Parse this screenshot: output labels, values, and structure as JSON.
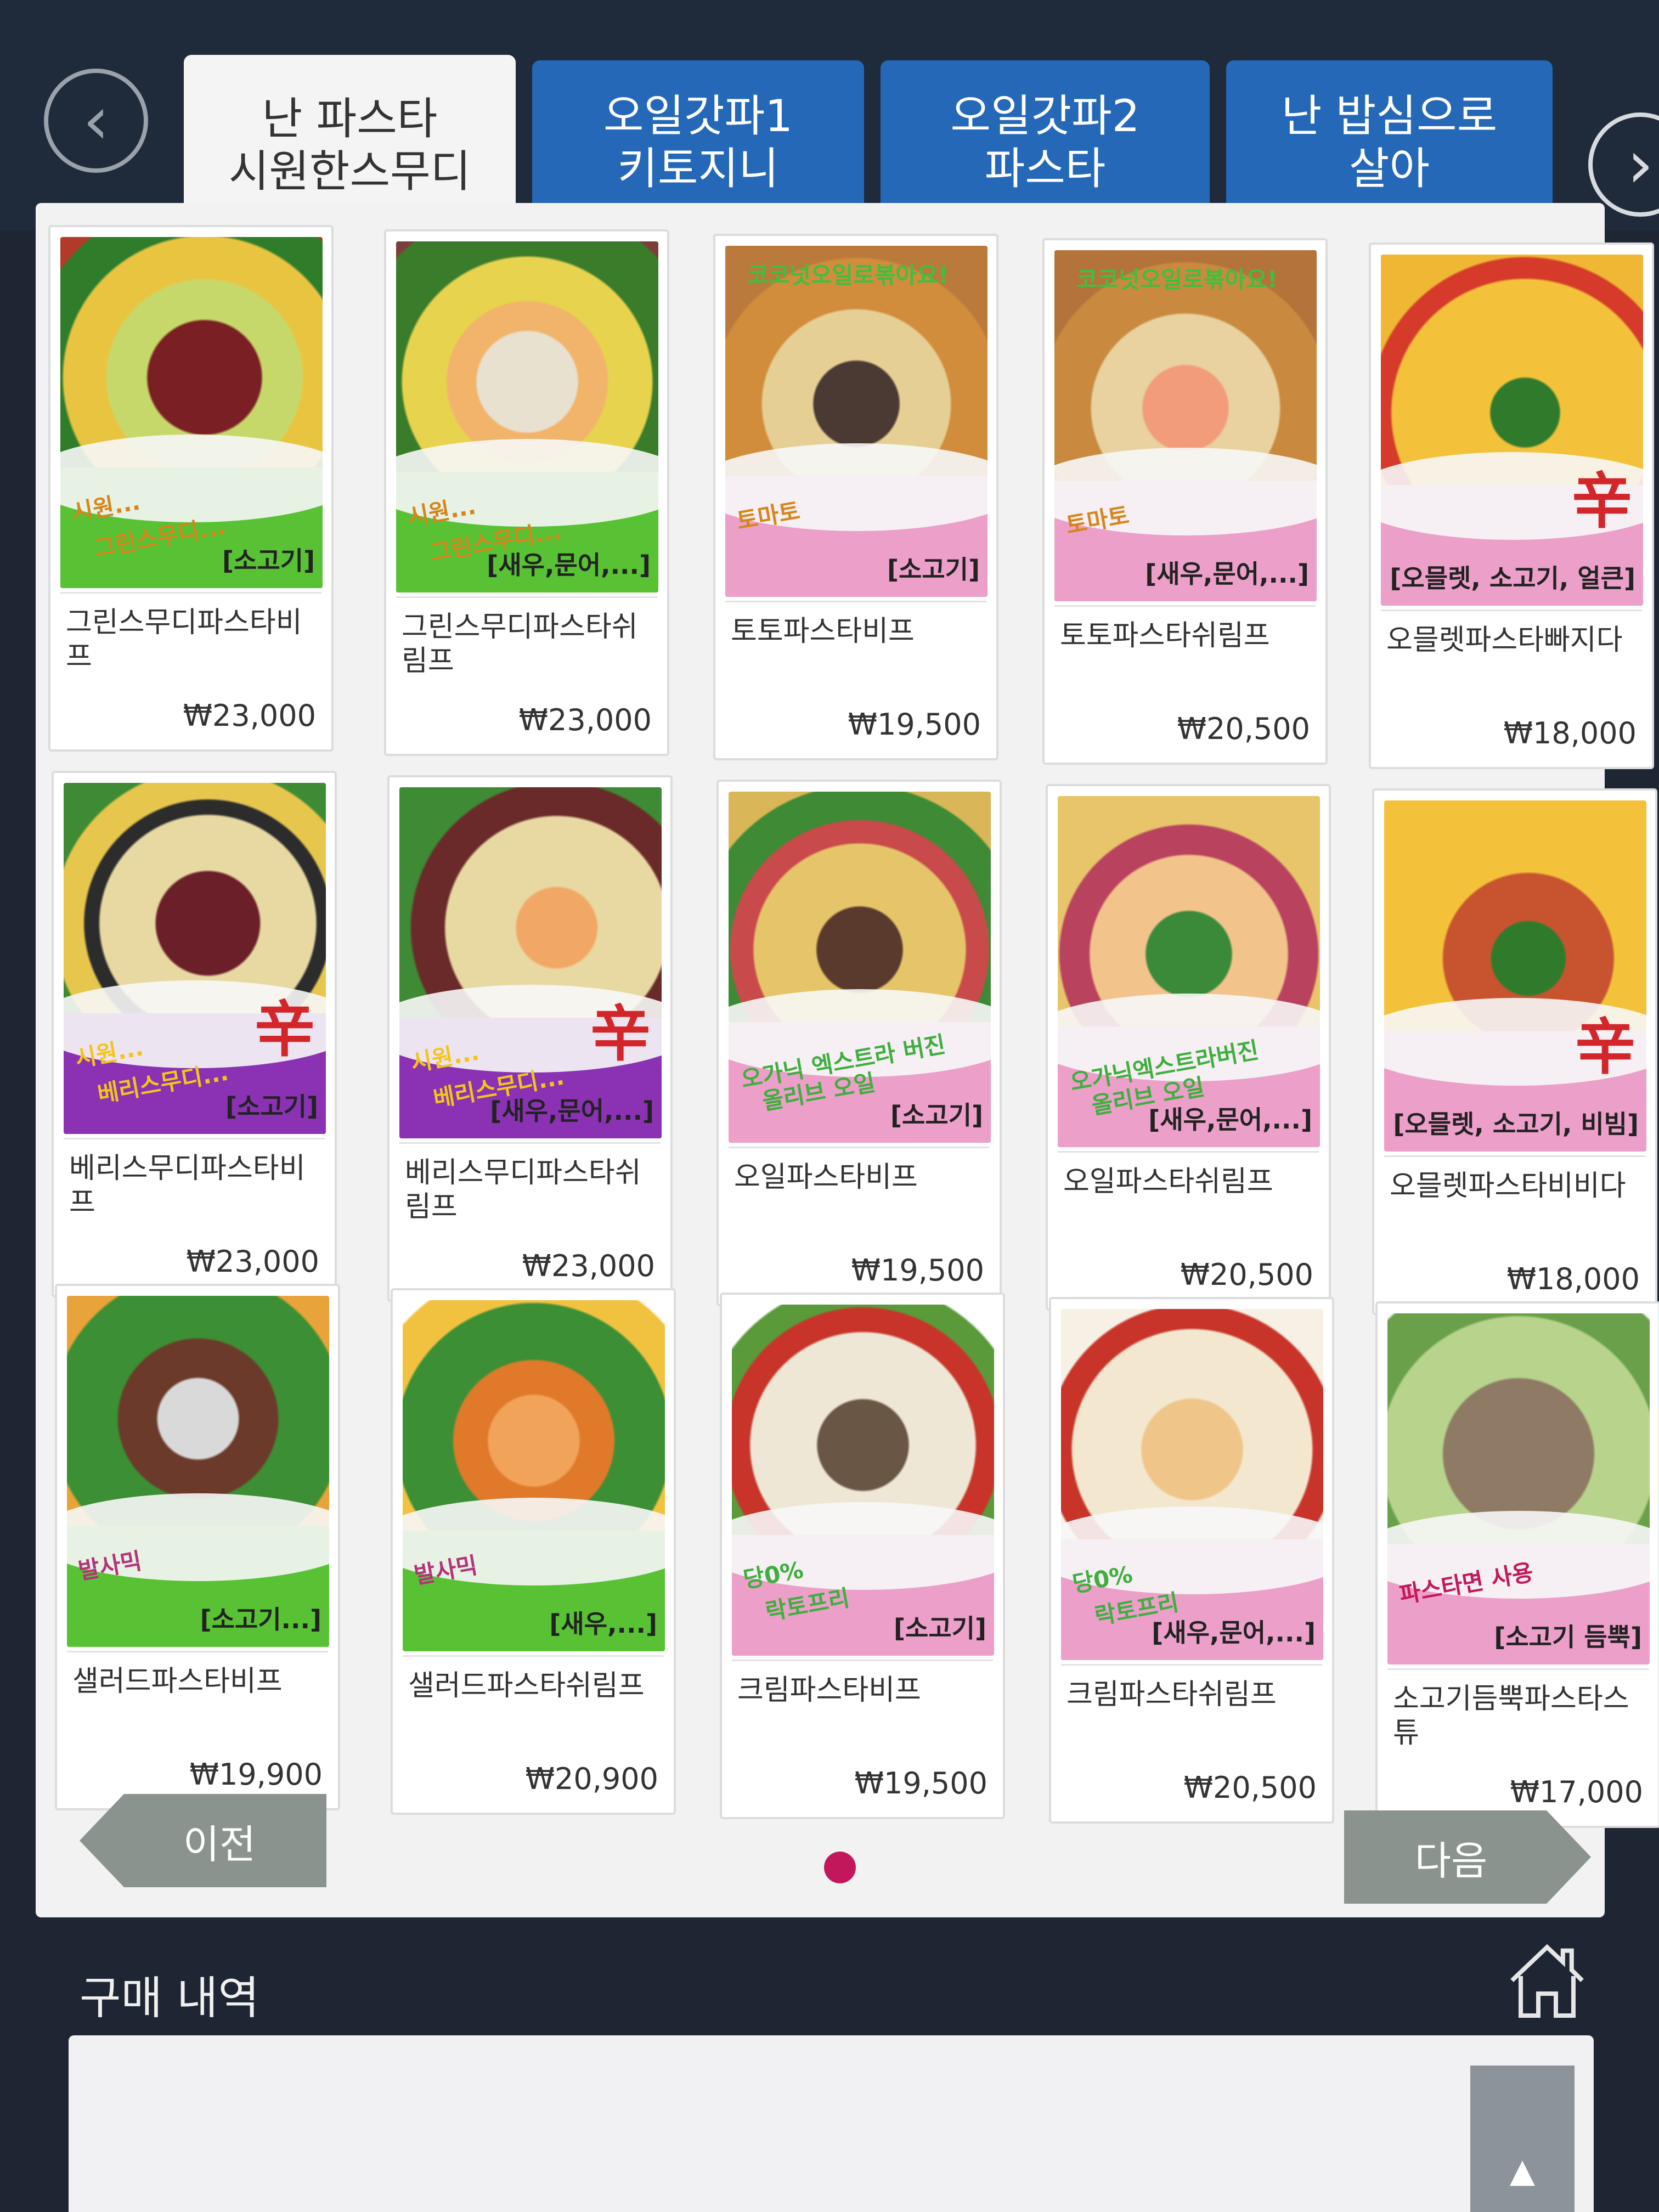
{
  "tabs": [
    {
      "line1": "난 파스타",
      "line2": "시원한스무디",
      "active": true
    },
    {
      "line1": "오일갓파1",
      "line2": "키토지니",
      "active": false
    },
    {
      "line1": "오일갓파2",
      "line2": "파스타",
      "active": false
    },
    {
      "line1": "난 밥심으로",
      "line2": "살아",
      "active": false
    }
  ],
  "menu_items": [
    {
      "name": "그린스무디파스타비프",
      "price": "₩23,000",
      "tag": "[소고기]",
      "hand1": "시원...",
      "hand2": "그린스무디...",
      "spicy": ""
    },
    {
      "name": "그린스무디파스타쉬림프",
      "price": "₩23,000",
      "tag": "[새우,문어,...]",
      "hand1": "시원...",
      "hand2": "그린스무디...",
      "spicy": ""
    },
    {
      "name": "토토파스타비프",
      "price": "₩19,500",
      "tag": "[소고기]",
      "hand1": "토마토",
      "hand2": "",
      "top_text": "코코넛오일로볶아요!",
      "spicy": ""
    },
    {
      "name": "토토파스타쉬림프",
      "price": "₩20,500",
      "tag": "[새우,문어,...]",
      "hand1": "토마토",
      "hand2": "",
      "top_text": "코코넛오일로볶아요!",
      "spicy": ""
    },
    {
      "name": "오믈렛파스타빠지다",
      "price": "₩18,000",
      "tag": "[오믈렛, 소고기, 얼큰]",
      "hand1": "",
      "hand2": "",
      "spicy": "辛"
    },
    {
      "name": "베리스무디파스타비프",
      "price": "₩23,000",
      "tag": "[소고기]",
      "hand1": "시원...",
      "hand2": "베리스무디...",
      "spicy": "辛"
    },
    {
      "name": "베리스무디파스타쉬림프",
      "price": "₩23,000",
      "tag": "[새우,문어,...]",
      "hand1": "시원...",
      "hand2": "베리스무디...",
      "spicy": "辛"
    },
    {
      "name": "오일파스타비프",
      "price": "₩19,500",
      "tag": "[소고기]",
      "hand1": "오가닉 엑스트라 버진",
      "hand2": "올리브 오일",
      "spicy": ""
    },
    {
      "name": "오일파스타쉬림프",
      "price": "₩20,500",
      "tag": "[새우,문어,...]",
      "hand1": "오가닉엑스트라버진",
      "hand2": "올리브 오일",
      "spicy": ""
    },
    {
      "name": "오믈렛파스타비비다",
      "price": "₩18,000",
      "tag": "[오믈렛, 소고기, 비빔]",
      "hand1": "",
      "hand2": "",
      "spicy": "辛"
    },
    {
      "name": "샐러드파스타비프",
      "price": "₩19,900",
      "tag": "[소고기...]",
      "hand1": "발사믹",
      "hand2": "",
      "spicy": ""
    },
    {
      "name": "샐러드파스타쉬림프",
      "price": "₩20,900",
      "tag": "[새우,...]",
      "hand1": "발사믹",
      "hand2": "",
      "spicy": ""
    },
    {
      "name": "크림파스타비프",
      "price": "₩19,500",
      "tag": "[소고기]",
      "hand1": "당0%",
      "hand2": "락토프리",
      "spicy": ""
    },
    {
      "name": "크림파스타쉬림프",
      "price": "₩20,500",
      "tag": "[새우,문어,...]",
      "hand1": "당0%",
      "hand2": "락토프리",
      "spicy": ""
    },
    {
      "name": "소고기듬뿍파스타스튜",
      "price": "₩17,000",
      "tag": "[소고기 듬뿍]",
      "hand1": "파스타면 사용",
      "hand2": "",
      "spicy": ""
    }
  ],
  "pagination": {
    "prev_label": "이전",
    "next_label": "다음",
    "current_page": 1,
    "total_pages": 1
  },
  "history": {
    "label": "구매 내역",
    "scroll_up": "▲"
  },
  "colors": {
    "tab_inactive": "#2468b7",
    "band_green": "#58c234",
    "band_pink": "#ec9fc8",
    "band_purple": "#8a32b3",
    "band_pink_light": "#efa5c6",
    "page_dot": "#c2185b",
    "button_gray": "#8a938e"
  }
}
